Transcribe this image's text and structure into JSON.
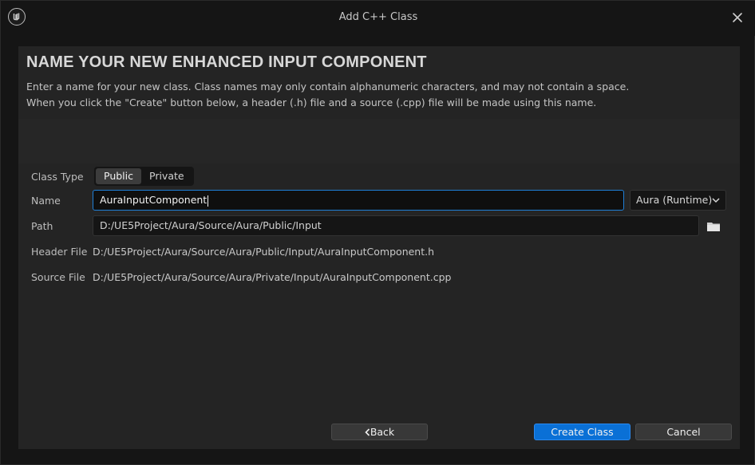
{
  "window": {
    "title": "Add C++ Class"
  },
  "header": {
    "heading": "NAME YOUR NEW ENHANCED INPUT COMPONENT",
    "description_line1": "Enter a name for your new class. Class names may only contain alphanumeric characters, and may not contain a space.",
    "description_line2": "When you click the \"Create\" button below, a header (.h) file and a source (.cpp) file will be made using this name."
  },
  "form": {
    "class_type_label": "Class Type",
    "class_type_options": [
      "Public",
      "Private"
    ],
    "class_type_selected": "Public",
    "name_label": "Name",
    "name_value": "AuraInputComponent",
    "module_value": "Aura (Runtime)",
    "path_label": "Path",
    "path_value": "D:/UE5Project/Aura/Source/Aura/Public/Input",
    "header_file_label": "Header File",
    "header_file_value": "D:/UE5Project/Aura/Source/Aura/Public/Input/AuraInputComponent.h",
    "source_file_label": "Source File",
    "source_file_value": "D:/UE5Project/Aura/Source/Aura/Private/Input/AuraInputComponent.cpp"
  },
  "buttons": {
    "back": "Back",
    "create": "Create Class",
    "cancel": "Cancel"
  },
  "colors": {
    "accent": "#0a70d6",
    "focus_border": "#1f7fd6",
    "panel": "#242424",
    "background": "#151515"
  },
  "icons": {
    "logo": "unreal-logo-icon",
    "close": "close-icon",
    "dropdown": "chevron-down-icon",
    "browse": "folder-icon",
    "back": "chevron-left-icon"
  }
}
